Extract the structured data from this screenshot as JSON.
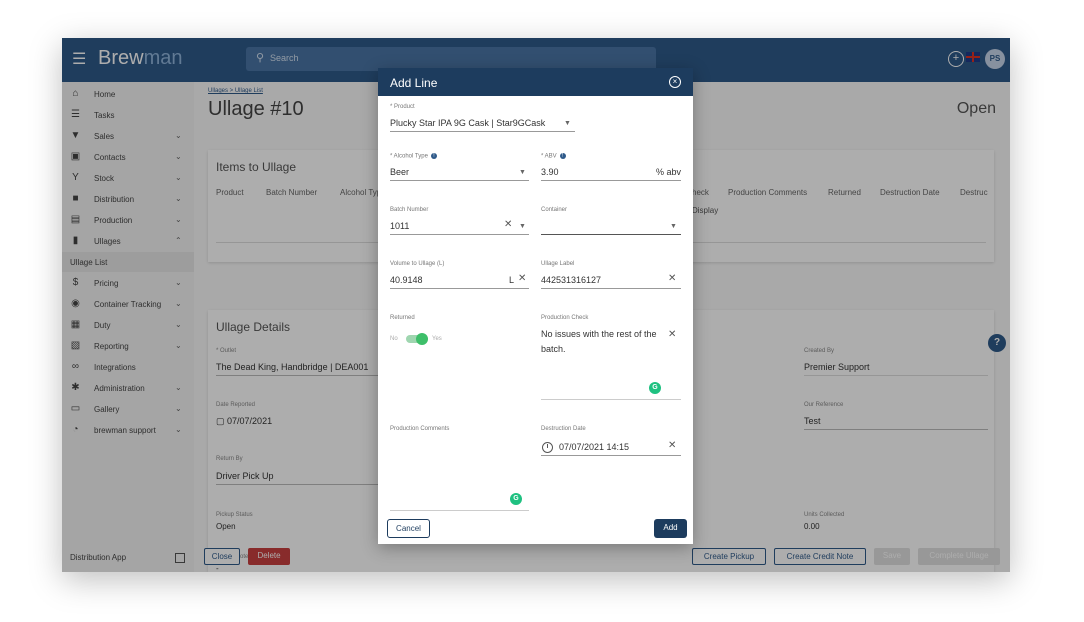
{
  "app": {
    "logo_main": "Brew",
    "logo_accent": "man",
    "search_placeholder": "Search",
    "user_initials": "PS"
  },
  "sidebar": {
    "items": [
      {
        "label": "Home",
        "icon": "home-icon"
      },
      {
        "label": "Tasks",
        "icon": "list-icon"
      },
      {
        "label": "Sales",
        "icon": "basket-icon"
      },
      {
        "label": "Contacts",
        "icon": "contacts-icon"
      },
      {
        "label": "Stock",
        "icon": "stock-icon"
      },
      {
        "label": "Distribution",
        "icon": "truck-icon"
      },
      {
        "label": "Production",
        "icon": "production-icon"
      },
      {
        "label": "Ullages",
        "icon": "ullage-icon"
      },
      {
        "label": "Ullage List",
        "icon": ""
      },
      {
        "label": "Pricing",
        "icon": "pricing-icon"
      },
      {
        "label": "Container Tracking",
        "icon": "tracking-icon"
      },
      {
        "label": "Duty",
        "icon": "duty-icon"
      },
      {
        "label": "Reporting",
        "icon": "reporting-icon"
      },
      {
        "label": "Integrations",
        "icon": "link-icon"
      },
      {
        "label": "Administration",
        "icon": "gear-icon"
      },
      {
        "label": "Gallery",
        "icon": "gallery-icon"
      },
      {
        "label": "brewman support",
        "icon": "support-icon"
      }
    ],
    "distribution_app": "Distribution App"
  },
  "page": {
    "breadcrumb": "Ullages > Ullage List",
    "title": "Ullage #10",
    "status": "Open",
    "items_card": {
      "title": "Items to Ullage",
      "headers_left": [
        "Product",
        "Batch Number",
        "Alcohol Typ"
      ],
      "headers_right": [
        "heck",
        "Production Comments",
        "Returned",
        "Destruction Date",
        "Destruc"
      ],
      "display_text": "Display"
    },
    "details": {
      "title": "Ullage Details",
      "outlet_label": "* Outlet",
      "outlet_value": "The Dead King, Handbridge | DEA001",
      "date_reported_label": "Date Reported",
      "date_reported_value": "07/07/2021",
      "return_by_label": "Return By",
      "return_by_value": "Driver Pick Up",
      "pickup_status_label": "Pickup Status",
      "pickup_status_value": "Open",
      "pickup_notes_label": "Pickup Notes",
      "pickup_notes_value": "-",
      "created_by_label": "Created By",
      "created_by_value": "Premier Support",
      "our_reference_label": "Our Reference",
      "our_reference_value": "Test",
      "units_collected_label": "Units Collected",
      "units_collected_value": "0.00"
    },
    "footer": {
      "close": "Close",
      "delete": "Delete",
      "create_pickup": "Create Pickup",
      "create_credit_note": "Create Credit Note",
      "save": "Save",
      "complete": "Complete Ullage"
    }
  },
  "modal": {
    "title": "Add Line",
    "product_label": "* Product",
    "product_value": "Plucky Star IPA 9G Cask | Star9GCask",
    "alcohol_type_label": "* Alcohol Type",
    "alcohol_type_value": "Beer",
    "abv_label": "* ABV",
    "abv_value": "3.90",
    "abv_unit": "% abv",
    "batch_label": "Batch Number",
    "batch_value": "1011",
    "container_label": "Container",
    "container_value": "",
    "volume_label": "Volume to Ullage (L)",
    "volume_value": "40.9148",
    "volume_unit": "L",
    "ullage_label_label": "Ullage Label",
    "ullage_label_value": "442531316127",
    "returned_label": "Returned",
    "returned_no": "No",
    "returned_yes": "Yes",
    "production_check_label": "Production Check",
    "production_check_line1": "No issues with the rest of the",
    "production_check_line2": "batch.",
    "production_comments_label": "Production Comments",
    "destruction_date_label": "Destruction Date",
    "destruction_date_value": "07/07/2021 14:15",
    "cancel": "Cancel",
    "add": "Add"
  },
  "colors": {
    "primary": "#2f5a8a",
    "header": "#1d3c5e",
    "danger": "#c94040",
    "toggle": "#3ebf6a"
  }
}
